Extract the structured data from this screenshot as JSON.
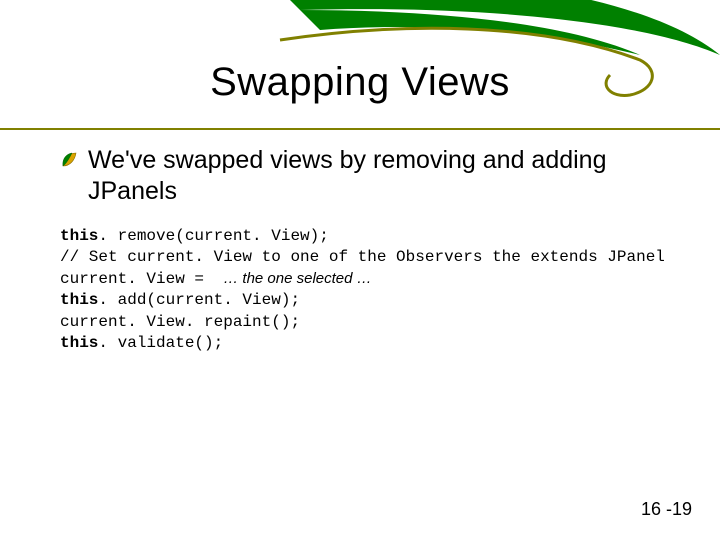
{
  "slide": {
    "title": "Swapping Views",
    "bullet": "We've swapped views by removing and adding JPanels",
    "code": {
      "l1a": "this",
      "l1b": ". remove(current. View);",
      "l2": "// Set current. View to one of the Observers the extends JPanel",
      "l3a": "current. View =  ",
      "l3b": "… the one selected …",
      "l4a": "this",
      "l4b": ". add(current. View);",
      "l5": "current. View. repaint();",
      "l6a": "this",
      "l6b": ". validate();"
    },
    "number": "16 -19"
  },
  "colors": {
    "olive": "#808000",
    "green": "#008000",
    "orange": "#d9a300"
  }
}
